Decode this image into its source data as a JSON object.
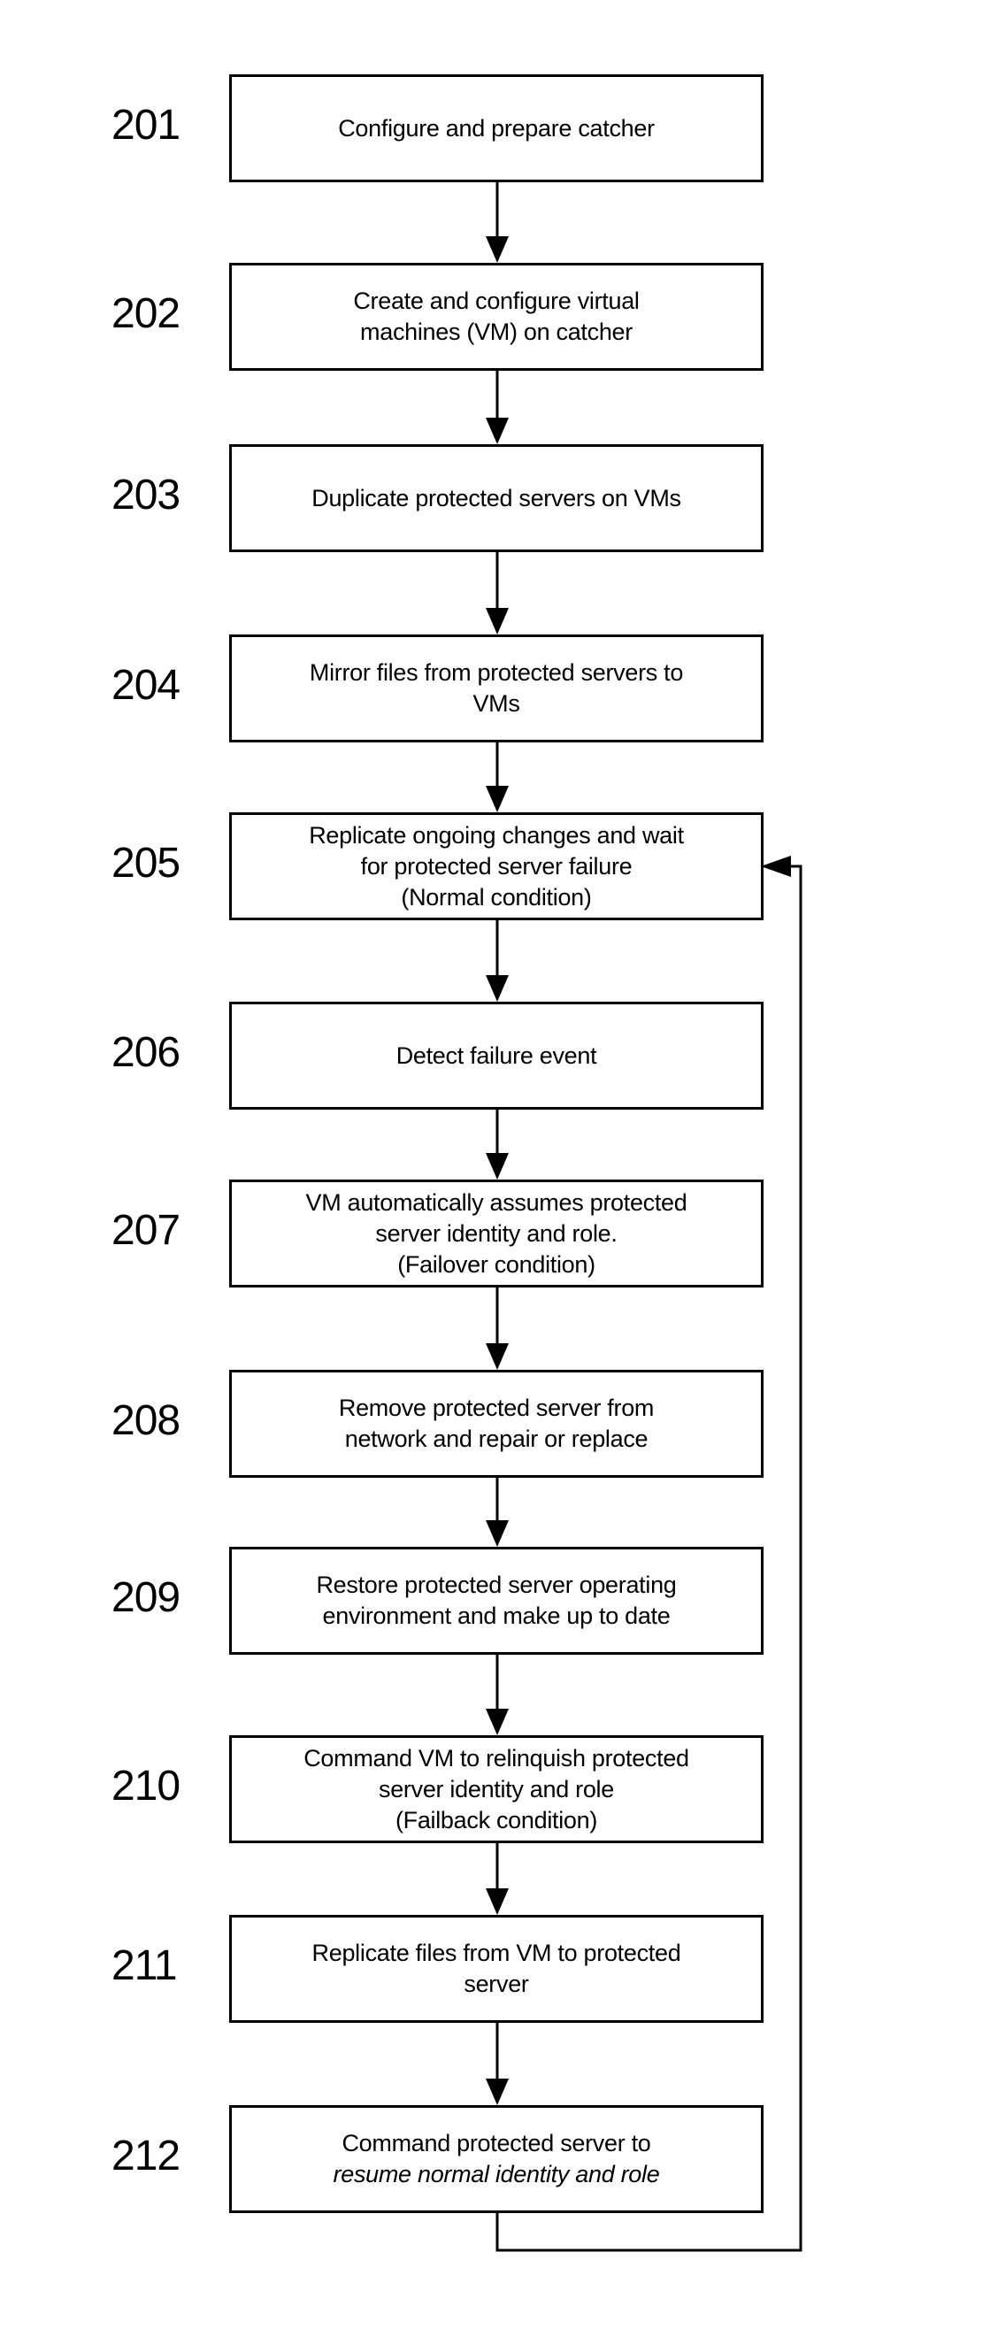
{
  "figure": {
    "type": "flowchart",
    "loop_back": {
      "from_step": "212",
      "to_step": "205"
    },
    "steps": [
      {
        "id": "201",
        "lines": [
          "Configure and prepare catcher"
        ]
      },
      {
        "id": "202",
        "lines": [
          "Create and configure virtual",
          "machines (VM) on catcher"
        ]
      },
      {
        "id": "203",
        "lines": [
          "Duplicate protected servers on VMs"
        ]
      },
      {
        "id": "204",
        "lines": [
          "Mirror files from protected servers to",
          "VMs"
        ]
      },
      {
        "id": "205",
        "lines": [
          "Replicate ongoing changes and wait",
          "for protected server failure",
          "(Normal condition)"
        ]
      },
      {
        "id": "206",
        "lines": [
          "Detect failure event"
        ]
      },
      {
        "id": "207",
        "lines": [
          "VM automatically assumes protected",
          "server identity and role.",
          "(Failover condition)"
        ]
      },
      {
        "id": "208",
        "lines": [
          "Remove protected server from",
          "network and repair or replace"
        ]
      },
      {
        "id": "209",
        "lines": [
          "Restore protected server operating",
          "environment and make up to date"
        ]
      },
      {
        "id": "210",
        "lines": [
          "Command VM to relinquish protected",
          "server identity and role",
          "(Failback condition)"
        ]
      },
      {
        "id": "211",
        "lines": [
          "Replicate files from VM to protected",
          "server"
        ]
      },
      {
        "id": "212",
        "lines": [
          "Command protected server to",
          "resume normal identity and role"
        ],
        "italic_line": 1
      }
    ]
  }
}
